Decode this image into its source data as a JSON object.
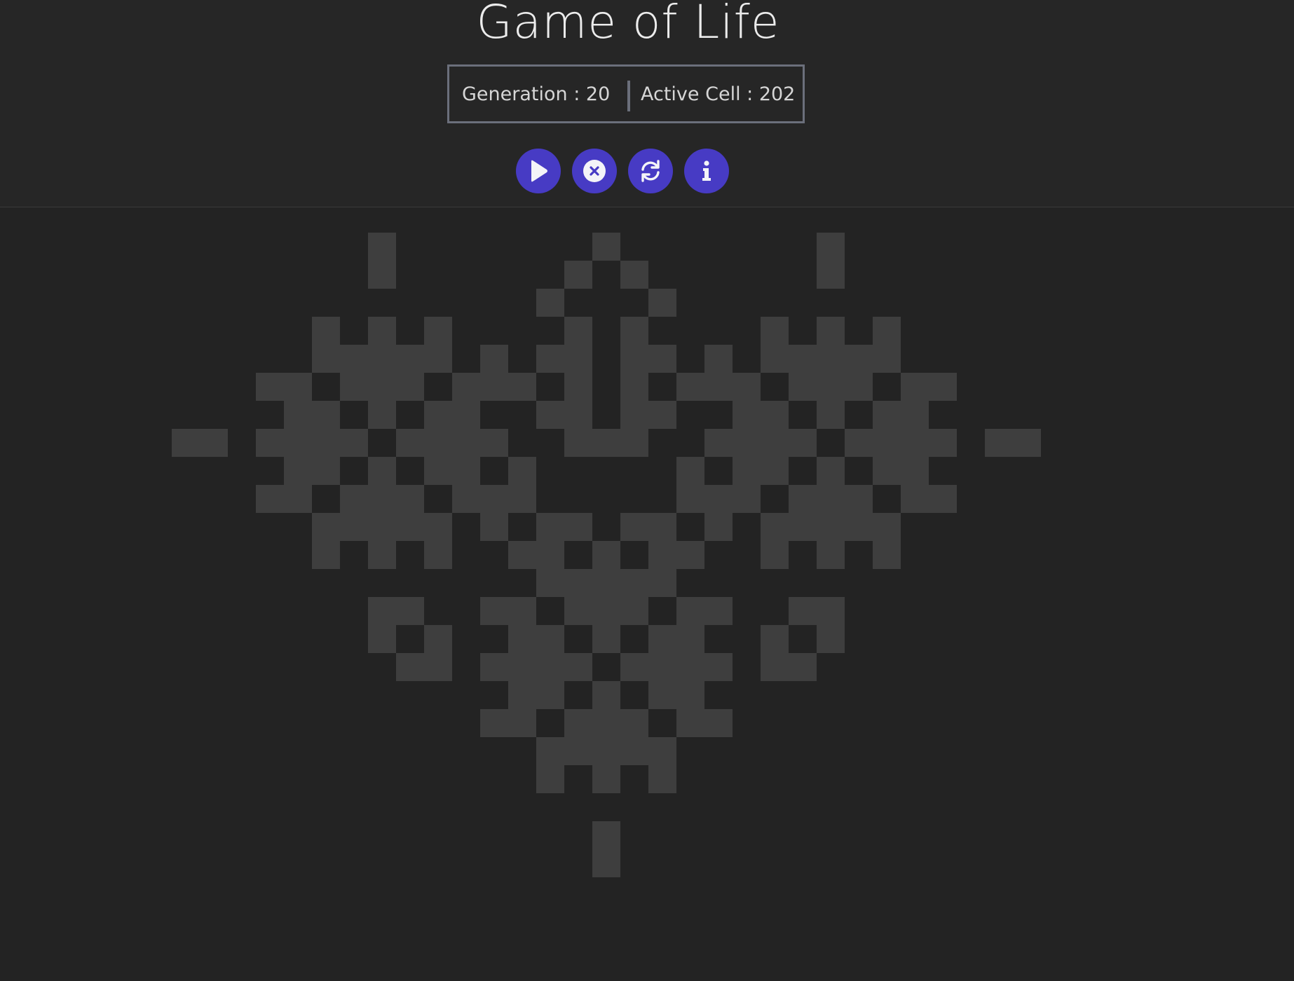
{
  "title": "Game of Life",
  "stats": {
    "generation_text": "Generation : 20",
    "active_cell_text": "Active Cell : 202"
  },
  "controls": [
    {
      "name": "play-button",
      "icon": "play-icon"
    },
    {
      "name": "clear-button",
      "icon": "close-circle-icon"
    },
    {
      "name": "reset-button",
      "icon": "refresh-icon"
    },
    {
      "name": "info-button",
      "icon": "info-icon"
    }
  ],
  "colors": {
    "background": "#232323",
    "header_background": "#262626",
    "accent": "#473bc4",
    "live_cell": "#3e3e3e",
    "stats_border": "#6b6f7b"
  },
  "board": {
    "live_cells": [
      [
        13,
        2
      ],
      [
        21,
        2
      ],
      [
        29,
        2
      ],
      [
        13,
        3
      ],
      [
        20,
        3
      ],
      [
        22,
        3
      ],
      [
        29,
        3
      ],
      [
        19,
        4
      ],
      [
        23,
        4
      ],
      [
        11,
        5
      ],
      [
        13,
        5
      ],
      [
        15,
        5
      ],
      [
        20,
        5
      ],
      [
        22,
        5
      ],
      [
        27,
        5
      ],
      [
        29,
        5
      ],
      [
        31,
        5
      ],
      [
        11,
        6
      ],
      [
        12,
        6
      ],
      [
        13,
        6
      ],
      [
        14,
        6
      ],
      [
        15,
        6
      ],
      [
        17,
        6
      ],
      [
        19,
        6
      ],
      [
        20,
        6
      ],
      [
        22,
        6
      ],
      [
        23,
        6
      ],
      [
        25,
        6
      ],
      [
        27,
        6
      ],
      [
        28,
        6
      ],
      [
        29,
        6
      ],
      [
        30,
        6
      ],
      [
        31,
        6
      ],
      [
        9,
        7
      ],
      [
        10,
        7
      ],
      [
        12,
        7
      ],
      [
        13,
        7
      ],
      [
        14,
        7
      ],
      [
        16,
        7
      ],
      [
        17,
        7
      ],
      [
        18,
        7
      ],
      [
        20,
        7
      ],
      [
        22,
        7
      ],
      [
        24,
        7
      ],
      [
        25,
        7
      ],
      [
        26,
        7
      ],
      [
        28,
        7
      ],
      [
        29,
        7
      ],
      [
        30,
        7
      ],
      [
        32,
        7
      ],
      [
        33,
        7
      ],
      [
        10,
        8
      ],
      [
        11,
        8
      ],
      [
        13,
        8
      ],
      [
        15,
        8
      ],
      [
        16,
        8
      ],
      [
        19,
        8
      ],
      [
        20,
        8
      ],
      [
        22,
        8
      ],
      [
        23,
        8
      ],
      [
        26,
        8
      ],
      [
        27,
        8
      ],
      [
        29,
        8
      ],
      [
        31,
        8
      ],
      [
        32,
        8
      ],
      [
        6,
        9
      ],
      [
        7,
        9
      ],
      [
        9,
        9
      ],
      [
        10,
        9
      ],
      [
        11,
        9
      ],
      [
        12,
        9
      ],
      [
        14,
        9
      ],
      [
        15,
        9
      ],
      [
        16,
        9
      ],
      [
        17,
        9
      ],
      [
        20,
        9
      ],
      [
        21,
        9
      ],
      [
        22,
        9
      ],
      [
        25,
        9
      ],
      [
        26,
        9
      ],
      [
        27,
        9
      ],
      [
        28,
        9
      ],
      [
        30,
        9
      ],
      [
        31,
        9
      ],
      [
        32,
        9
      ],
      [
        33,
        9
      ],
      [
        35,
        9
      ],
      [
        36,
        9
      ],
      [
        10,
        10
      ],
      [
        11,
        10
      ],
      [
        13,
        10
      ],
      [
        15,
        10
      ],
      [
        16,
        10
      ],
      [
        18,
        10
      ],
      [
        24,
        10
      ],
      [
        26,
        10
      ],
      [
        27,
        10
      ],
      [
        29,
        10
      ],
      [
        31,
        10
      ],
      [
        32,
        10
      ],
      [
        9,
        11
      ],
      [
        10,
        11
      ],
      [
        12,
        11
      ],
      [
        13,
        11
      ],
      [
        14,
        11
      ],
      [
        16,
        11
      ],
      [
        17,
        11
      ],
      [
        18,
        11
      ],
      [
        24,
        11
      ],
      [
        25,
        11
      ],
      [
        26,
        11
      ],
      [
        28,
        11
      ],
      [
        29,
        11
      ],
      [
        30,
        11
      ],
      [
        32,
        11
      ],
      [
        33,
        11
      ],
      [
        11,
        12
      ],
      [
        12,
        12
      ],
      [
        13,
        12
      ],
      [
        14,
        12
      ],
      [
        15,
        12
      ],
      [
        17,
        12
      ],
      [
        19,
        12
      ],
      [
        20,
        12
      ],
      [
        22,
        12
      ],
      [
        23,
        12
      ],
      [
        25,
        12
      ],
      [
        27,
        12
      ],
      [
        28,
        12
      ],
      [
        29,
        12
      ],
      [
        30,
        12
      ],
      [
        31,
        12
      ],
      [
        11,
        13
      ],
      [
        13,
        13
      ],
      [
        15,
        13
      ],
      [
        18,
        13
      ],
      [
        19,
        13
      ],
      [
        21,
        13
      ],
      [
        23,
        13
      ],
      [
        24,
        13
      ],
      [
        27,
        13
      ],
      [
        29,
        13
      ],
      [
        31,
        13
      ],
      [
        19,
        14
      ],
      [
        20,
        14
      ],
      [
        21,
        14
      ],
      [
        22,
        14
      ],
      [
        23,
        14
      ],
      [
        13,
        15
      ],
      [
        14,
        15
      ],
      [
        17,
        15
      ],
      [
        18,
        15
      ],
      [
        20,
        15
      ],
      [
        21,
        15
      ],
      [
        22,
        15
      ],
      [
        24,
        15
      ],
      [
        25,
        15
      ],
      [
        28,
        15
      ],
      [
        29,
        15
      ],
      [
        13,
        16
      ],
      [
        15,
        16
      ],
      [
        18,
        16
      ],
      [
        19,
        16
      ],
      [
        21,
        16
      ],
      [
        23,
        16
      ],
      [
        24,
        16
      ],
      [
        27,
        16
      ],
      [
        29,
        16
      ],
      [
        14,
        17
      ],
      [
        15,
        17
      ],
      [
        17,
        17
      ],
      [
        18,
        17
      ],
      [
        19,
        17
      ],
      [
        20,
        17
      ],
      [
        22,
        17
      ],
      [
        23,
        17
      ],
      [
        24,
        17
      ],
      [
        25,
        17
      ],
      [
        27,
        17
      ],
      [
        28,
        17
      ],
      [
        18,
        18
      ],
      [
        19,
        18
      ],
      [
        21,
        18
      ],
      [
        23,
        18
      ],
      [
        24,
        18
      ],
      [
        17,
        19
      ],
      [
        18,
        19
      ],
      [
        20,
        19
      ],
      [
        21,
        19
      ],
      [
        22,
        19
      ],
      [
        24,
        19
      ],
      [
        25,
        19
      ],
      [
        19,
        20
      ],
      [
        20,
        20
      ],
      [
        21,
        20
      ],
      [
        22,
        20
      ],
      [
        23,
        20
      ],
      [
        19,
        21
      ],
      [
        21,
        21
      ],
      [
        23,
        21
      ],
      [
        21,
        23
      ],
      [
        21,
        24
      ]
    ]
  }
}
